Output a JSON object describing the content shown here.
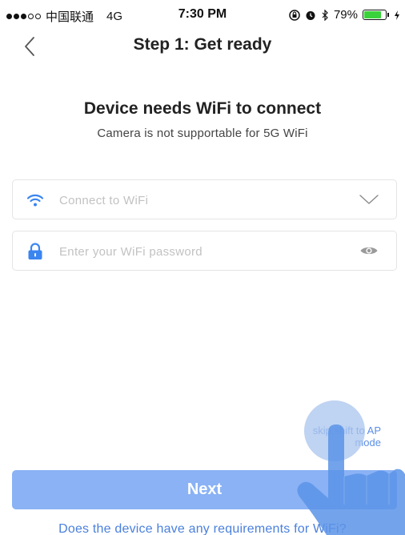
{
  "status_bar": {
    "carrier": "中国联通",
    "network": "4G",
    "time": "7:30 PM",
    "battery_percent": "79%",
    "battery_level": 0.79,
    "battery_color": "#3ad23a"
  },
  "nav": {
    "title": "Step 1: Get ready"
  },
  "main": {
    "heading": "Device needs WiFi to connect",
    "subheading": "Camera is not supportable for 5G WiFi"
  },
  "wifi_field": {
    "placeholder": "Connect to WiFi",
    "value": ""
  },
  "password_field": {
    "placeholder": "Enter your WiFi password",
    "value": ""
  },
  "skip_link": {
    "line1": "skip,shift to AP",
    "line2": "mode"
  },
  "next_button": {
    "label": "Next"
  },
  "requirements_link": {
    "label": "Does the device have any requirements for WiFi?"
  },
  "icons": {
    "back": "chevron-left-icon",
    "wifi": "wifi-icon",
    "dropdown": "chevron-down-icon",
    "lock": "lock-icon",
    "eye": "eye-icon"
  },
  "colors": {
    "accent_blue": "#3a85f0",
    "button_blue": "#8ab2f5",
    "link_blue": "#4a80dd"
  }
}
